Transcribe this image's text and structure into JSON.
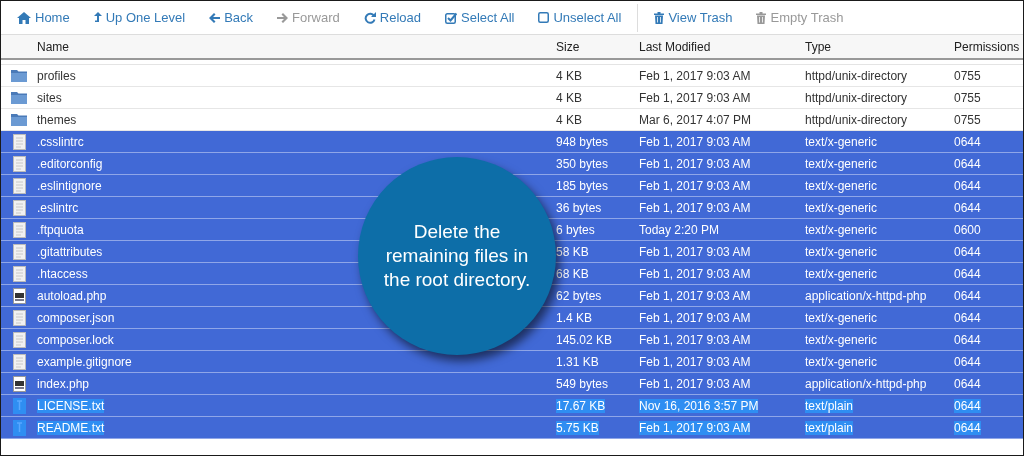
{
  "toolbar": [
    {
      "label": "Home",
      "disabled": false
    },
    {
      "label": "Up One Level",
      "disabled": false
    },
    {
      "label": "Back",
      "disabled": false
    },
    {
      "label": "Forward",
      "disabled": true
    },
    {
      "label": "Reload",
      "disabled": false
    },
    {
      "label": "Select All",
      "disabled": false
    },
    {
      "label": "Unselect All",
      "disabled": false
    },
    {
      "label": "View Trash",
      "disabled": false
    },
    {
      "label": "Empty Trash",
      "disabled": true
    }
  ],
  "table": {
    "columns": [
      "Name",
      "Size",
      "Last Modified",
      "Type",
      "Permissions"
    ],
    "rows": [
      {
        "kind": "folder",
        "name": "profiles",
        "size": "4 KB",
        "modified": "Feb 1, 2017 9:03 AM",
        "type": "httpd/unix-directory",
        "permissions": "0755",
        "selected": false,
        "highlighted": false
      },
      {
        "kind": "folder",
        "name": "sites",
        "size": "4 KB",
        "modified": "Feb 1, 2017 9:03 AM",
        "type": "httpd/unix-directory",
        "permissions": "0755",
        "selected": false,
        "highlighted": false
      },
      {
        "kind": "folder",
        "name": "themes",
        "size": "4 KB",
        "modified": "Mar 6, 2017 4:07 PM",
        "type": "httpd/unix-directory",
        "permissions": "0755",
        "selected": false,
        "highlighted": false
      },
      {
        "kind": "text",
        "name": ".csslintrc",
        "size": "948 bytes",
        "modified": "Feb 1, 2017 9:03 AM",
        "type": "text/x-generic",
        "permissions": "0644",
        "selected": true,
        "highlighted": false
      },
      {
        "kind": "text",
        "name": ".editorconfig",
        "size": "350 bytes",
        "modified": "Feb 1, 2017 9:03 AM",
        "type": "text/x-generic",
        "permissions": "0644",
        "selected": true,
        "highlighted": false
      },
      {
        "kind": "text",
        "name": ".eslintignore",
        "size": "185 bytes",
        "modified": "Feb 1, 2017 9:03 AM",
        "type": "text/x-generic",
        "permissions": "0644",
        "selected": true,
        "highlighted": false
      },
      {
        "kind": "text",
        "name": ".eslintrc",
        "size": "36 bytes",
        "modified": "Feb 1, 2017 9:03 AM",
        "type": "text/x-generic",
        "permissions": "0644",
        "selected": true,
        "highlighted": false
      },
      {
        "kind": "text",
        "name": ".ftpquota",
        "size": "6 bytes",
        "modified": "Today 2:20 PM",
        "type": "text/x-generic",
        "permissions": "0600",
        "selected": true,
        "highlighted": false
      },
      {
        "kind": "text",
        "name": ".gitattributes",
        "size": "58 KB",
        "modified": "Feb 1, 2017 9:03 AM",
        "type": "text/x-generic",
        "permissions": "0644",
        "selected": true,
        "highlighted": false
      },
      {
        "kind": "text",
        "name": ".htaccess",
        "size": "68 KB",
        "modified": "Feb 1, 2017 9:03 AM",
        "type": "text/x-generic",
        "permissions": "0644",
        "selected": true,
        "highlighted": false
      },
      {
        "kind": "php",
        "name": "autoload.php",
        "size": "62 bytes",
        "modified": "Feb 1, 2017 9:03 AM",
        "type": "application/x-httpd-php",
        "permissions": "0644",
        "selected": true,
        "highlighted": false
      },
      {
        "kind": "text",
        "name": "composer.json",
        "size": "1.4 KB",
        "modified": "Feb 1, 2017 9:03 AM",
        "type": "text/x-generic",
        "permissions": "0644",
        "selected": true,
        "highlighted": false
      },
      {
        "kind": "text",
        "name": "composer.lock",
        "size": "145.02 KB",
        "modified": "Feb 1, 2017 9:03 AM",
        "type": "text/x-generic",
        "permissions": "0644",
        "selected": true,
        "highlighted": false
      },
      {
        "kind": "text",
        "name": "example.gitignore",
        "size": "1.31 KB",
        "modified": "Feb 1, 2017 9:03 AM",
        "type": "text/x-generic",
        "permissions": "0644",
        "selected": true,
        "highlighted": false
      },
      {
        "kind": "php",
        "name": "index.php",
        "size": "549 bytes",
        "modified": "Feb 1, 2017 9:03 AM",
        "type": "application/x-httpd-php",
        "permissions": "0644",
        "selected": true,
        "highlighted": false
      },
      {
        "kind": "plain",
        "name": "LICENSE.txt",
        "size": "17.67 KB",
        "modified": "Nov 16, 2016 3:57 PM",
        "type": "text/plain",
        "permissions": "0644",
        "selected": true,
        "highlighted": true
      },
      {
        "kind": "plain",
        "name": "README.txt",
        "size": "5.75 KB",
        "modified": "Feb 1, 2017 9:03 AM",
        "type": "text/plain",
        "permissions": "0644",
        "selected": true,
        "highlighted": true
      }
    ]
  },
  "callout": {
    "text": "Delete the remaining files in the root directory."
  }
}
